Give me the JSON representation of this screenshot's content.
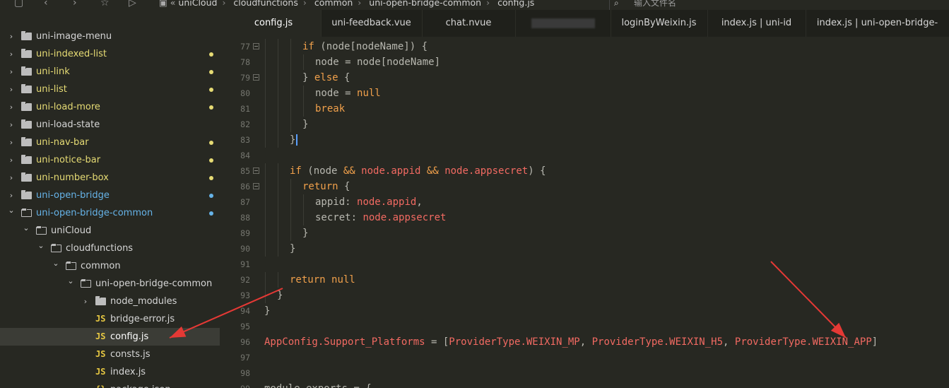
{
  "topbar": {
    "icons": [
      "file-icon",
      "back-icon",
      "forward-icon",
      "star-icon",
      "run-icon"
    ],
    "breadcrumb": [
      "uniCloud",
      "cloudfunctions",
      "common",
      "uni-open-bridge-common",
      "config.js"
    ],
    "search_placeholder": "输入文件名"
  },
  "sidebar": {
    "items": [
      {
        "label": "uni-image-menu",
        "depth": 0,
        "expanded": false,
        "kind": "folder",
        "dot": "",
        "color": "#d6d6d6"
      },
      {
        "label": "uni-indexed-list",
        "depth": 0,
        "expanded": false,
        "kind": "folder",
        "dot": "#e6db74",
        "color": "#e6db74"
      },
      {
        "label": "uni-link",
        "depth": 0,
        "expanded": false,
        "kind": "folder",
        "dot": "#e6db74",
        "color": "#e6db74"
      },
      {
        "label": "uni-list",
        "depth": 0,
        "expanded": false,
        "kind": "folder",
        "dot": "#e6db74",
        "color": "#e6db74"
      },
      {
        "label": "uni-load-more",
        "depth": 0,
        "expanded": false,
        "kind": "folder",
        "dot": "#e6db74",
        "color": "#e6db74"
      },
      {
        "label": "uni-load-state",
        "depth": 0,
        "expanded": false,
        "kind": "folder",
        "dot": "",
        "color": "#d6d6d6"
      },
      {
        "label": "uni-nav-bar",
        "depth": 0,
        "expanded": false,
        "kind": "folder",
        "dot": "#e6db74",
        "color": "#e6db74"
      },
      {
        "label": "uni-notice-bar",
        "depth": 0,
        "expanded": false,
        "kind": "folder",
        "dot": "#e6db74",
        "color": "#e6db74"
      },
      {
        "label": "uni-number-box",
        "depth": 0,
        "expanded": false,
        "kind": "folder",
        "dot": "#e6db74",
        "color": "#e6db74"
      },
      {
        "label": "uni-open-bridge",
        "depth": 0,
        "expanded": false,
        "kind": "folder",
        "dot": "#66b3e8",
        "color": "#66b3e8"
      },
      {
        "label": "uni-open-bridge-common",
        "depth": 0,
        "expanded": true,
        "kind": "folder",
        "dot": "#66b3e8",
        "color": "#66b3e8"
      },
      {
        "label": "uniCloud",
        "depth": 1,
        "expanded": true,
        "kind": "folder",
        "dot": "",
        "color": "#d6d6d6"
      },
      {
        "label": "cloudfunctions",
        "depth": 2,
        "expanded": true,
        "kind": "folder",
        "dot": "",
        "color": "#d6d6d6"
      },
      {
        "label": "common",
        "depth": 3,
        "expanded": true,
        "kind": "folder",
        "dot": "",
        "color": "#d6d6d6"
      },
      {
        "label": "uni-open-bridge-common",
        "depth": 4,
        "expanded": true,
        "kind": "folder",
        "dot": "",
        "color": "#d6d6d6"
      },
      {
        "label": "node_modules",
        "depth": 5,
        "expanded": false,
        "kind": "folder",
        "dot": "",
        "color": "#d6d6d6"
      },
      {
        "label": "bridge-error.js",
        "depth": 5,
        "kind": "js",
        "dot": "",
        "color": "#d6d6d6"
      },
      {
        "label": "config.js",
        "depth": 5,
        "kind": "js",
        "dot": "",
        "color": "#ffffff",
        "selected": true
      },
      {
        "label": "consts.js",
        "depth": 5,
        "kind": "js",
        "dot": "",
        "color": "#d6d6d6"
      },
      {
        "label": "index.js",
        "depth": 5,
        "kind": "js",
        "dot": "",
        "color": "#d6d6d6"
      },
      {
        "label": "package.json",
        "depth": 5,
        "kind": "json",
        "dot": "",
        "color": "#d6d6d6"
      }
    ],
    "js_badge": "JS"
  },
  "tabs": [
    {
      "label": "config.js",
      "active": true
    },
    {
      "label": "uni-feedback.vue",
      "active": false
    },
    {
      "label": "chat.nvue",
      "active": false
    },
    {
      "label": "",
      "active": false,
      "blurred": true
    },
    {
      "label": "loginByWeixin.js",
      "active": false
    },
    {
      "label": "index.js | uni-id",
      "active": false
    },
    {
      "label": "index.js | uni-open-bridge-",
      "active": false
    }
  ],
  "editor": {
    "lines": [
      {
        "n": "77",
        "fold": true,
        "indent": 3,
        "tokens": [
          [
            "k",
            "if"
          ],
          [
            "p",
            " (node[nodeName]) {"
          ]
        ]
      },
      {
        "n": "78",
        "fold": false,
        "indent": 4,
        "tokens": [
          [
            "p",
            "node = node[nodeName]"
          ]
        ]
      },
      {
        "n": "79",
        "fold": true,
        "indent": 3,
        "tokens": [
          [
            "p",
            "} "
          ],
          [
            "k",
            "else"
          ],
          [
            "p",
            " {"
          ]
        ]
      },
      {
        "n": "80",
        "fold": false,
        "indent": 4,
        "tokens": [
          [
            "p",
            "node = "
          ],
          [
            "nul",
            "null"
          ]
        ]
      },
      {
        "n": "81",
        "fold": false,
        "indent": 4,
        "tokens": [
          [
            "k",
            "break"
          ]
        ]
      },
      {
        "n": "82",
        "fold": false,
        "indent": 3,
        "tokens": [
          [
            "p",
            "}"
          ]
        ]
      },
      {
        "n": "83",
        "fold": false,
        "indent": 2,
        "tokens": [
          [
            "p",
            "}"
          ]
        ],
        "current": true
      },
      {
        "n": "84",
        "fold": false,
        "indent": 0,
        "tokens": []
      },
      {
        "n": "85",
        "fold": true,
        "indent": 2,
        "tokens": [
          [
            "k",
            "if"
          ],
          [
            "p",
            " (node "
          ],
          [
            "k",
            "&&"
          ],
          [
            "p",
            " "
          ],
          [
            "prop",
            "node.appid"
          ],
          [
            "p",
            " "
          ],
          [
            "k",
            "&&"
          ],
          [
            "p",
            " "
          ],
          [
            "prop",
            "node.appsecret"
          ],
          [
            "p",
            ") {"
          ]
        ]
      },
      {
        "n": "86",
        "fold": true,
        "indent": 3,
        "tokens": [
          [
            "k",
            "return"
          ],
          [
            "p",
            " {"
          ]
        ]
      },
      {
        "n": "87",
        "fold": false,
        "indent": 4,
        "tokens": [
          [
            "p",
            "appid: "
          ],
          [
            "prop",
            "node.appid"
          ],
          [
            "p",
            ","
          ]
        ]
      },
      {
        "n": "88",
        "fold": false,
        "indent": 4,
        "tokens": [
          [
            "p",
            "secret: "
          ],
          [
            "prop",
            "node.appsecret"
          ]
        ]
      },
      {
        "n": "89",
        "fold": false,
        "indent": 3,
        "tokens": [
          [
            "p",
            "}"
          ]
        ]
      },
      {
        "n": "90",
        "fold": false,
        "indent": 2,
        "tokens": [
          [
            "p",
            "}"
          ]
        ]
      },
      {
        "n": "91",
        "fold": false,
        "indent": 0,
        "tokens": []
      },
      {
        "n": "92",
        "fold": false,
        "indent": 2,
        "tokens": [
          [
            "k",
            "return"
          ],
          [
            "p",
            " "
          ],
          [
            "nul",
            "null"
          ]
        ]
      },
      {
        "n": "93",
        "fold": false,
        "indent": 1,
        "tokens": [
          [
            "p",
            "}"
          ]
        ]
      },
      {
        "n": "94",
        "fold": false,
        "indent": 0,
        "tokens": [
          [
            "p",
            "}"
          ]
        ]
      },
      {
        "n": "95",
        "fold": false,
        "indent": 0,
        "tokens": []
      },
      {
        "n": "96",
        "fold": false,
        "indent": 0,
        "tokens": [
          [
            "prop",
            "AppConfig.Support_Platforms"
          ],
          [
            "p",
            " = ["
          ],
          [
            "prop",
            "ProviderType.WEIXIN_MP"
          ],
          [
            "p",
            ", "
          ],
          [
            "prop",
            "ProviderType.WEIXIN_H5"
          ],
          [
            "p",
            ", "
          ],
          [
            "prop",
            "ProviderType.WEIXIN_APP"
          ],
          [
            "p",
            "]"
          ]
        ]
      },
      {
        "n": "97",
        "fold": false,
        "indent": 0,
        "tokens": []
      },
      {
        "n": "98",
        "fold": false,
        "indent": 0,
        "tokens": []
      },
      {
        "n": "99",
        "fold": false,
        "indent": 0,
        "tokens": [
          [
            "p",
            "module.exports = {"
          ]
        ]
      }
    ]
  },
  "colors": {
    "editor_bg": "#272822",
    "sidebar_bg": "#272822",
    "tab_bg": "#1f201b",
    "keyword": "#f0a04b",
    "property": "#f26a62",
    "arrow": "#e53935"
  }
}
